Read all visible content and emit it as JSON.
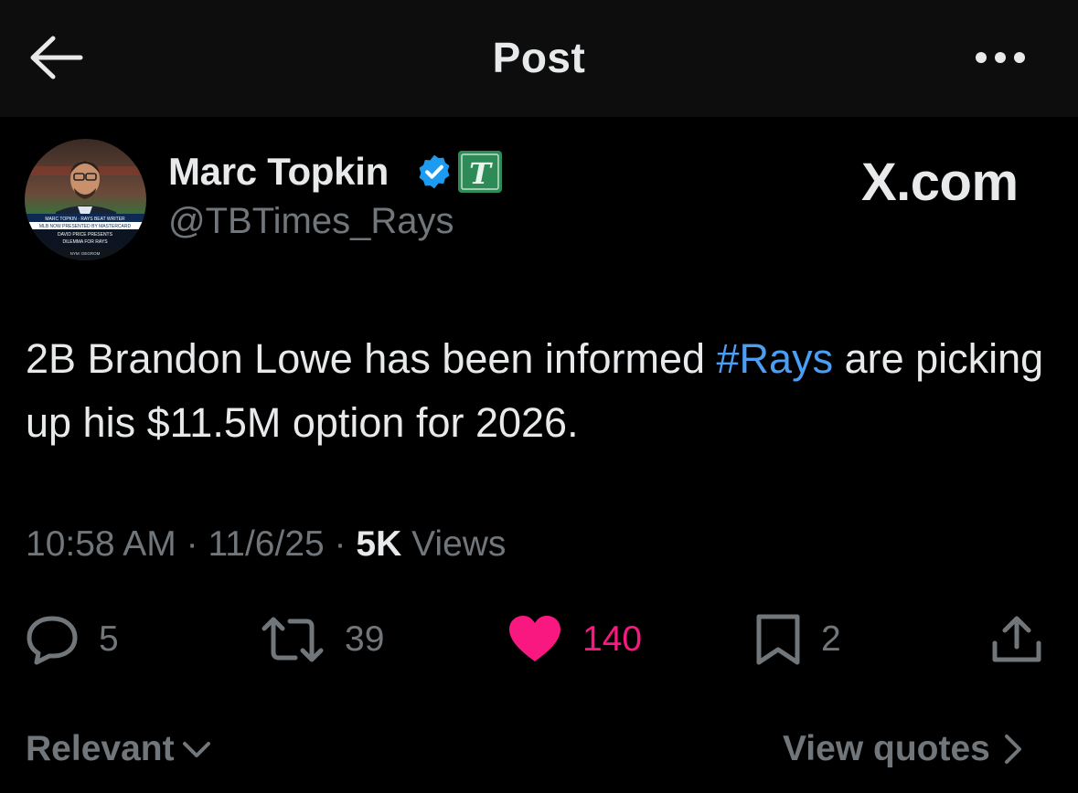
{
  "header": {
    "title": "Post",
    "back_icon": "arrow-left-icon",
    "more_icon": "more-horizontal-icon"
  },
  "author": {
    "name": "Marc Topkin",
    "handle": "@TBTimes_Rays",
    "verified_icon": "verified-badge-icon",
    "affiliate_badge_letter": "T",
    "avatar_caption_lines": [
      "MARC TOPKIN · RAYS BEAT WRITER",
      "MLB NOW PRESENTED BY MASTERCARD",
      "DAVID PRICE PRESENTS",
      "DILEMMA FOR RAYS",
      "NYM: DEGROM"
    ]
  },
  "watermark": "X.com",
  "tweet": {
    "text_before": "2B Brandon Lowe has been informed ",
    "hashtag": "#Rays",
    "text_after": " are picking up his $11.5M option for 2026."
  },
  "meta": {
    "time": "10:58 AM",
    "separator": "·",
    "date": "11/6/25",
    "views_count": "5K",
    "views_label": "Views"
  },
  "actions": {
    "replies": "5",
    "reposts": "39",
    "likes": "140",
    "bookmarks": "2"
  },
  "footer": {
    "sort_label": "Relevant",
    "quotes_label": "View quotes"
  },
  "colors": {
    "background": "#000000",
    "header_bg": "#0d0d0d",
    "text": "#e7e9ea",
    "muted": "#71767b",
    "link": "#4a9ff5",
    "like": "#f91880",
    "verified": "#1d9bf0",
    "affiliate": "#2e8b57"
  }
}
